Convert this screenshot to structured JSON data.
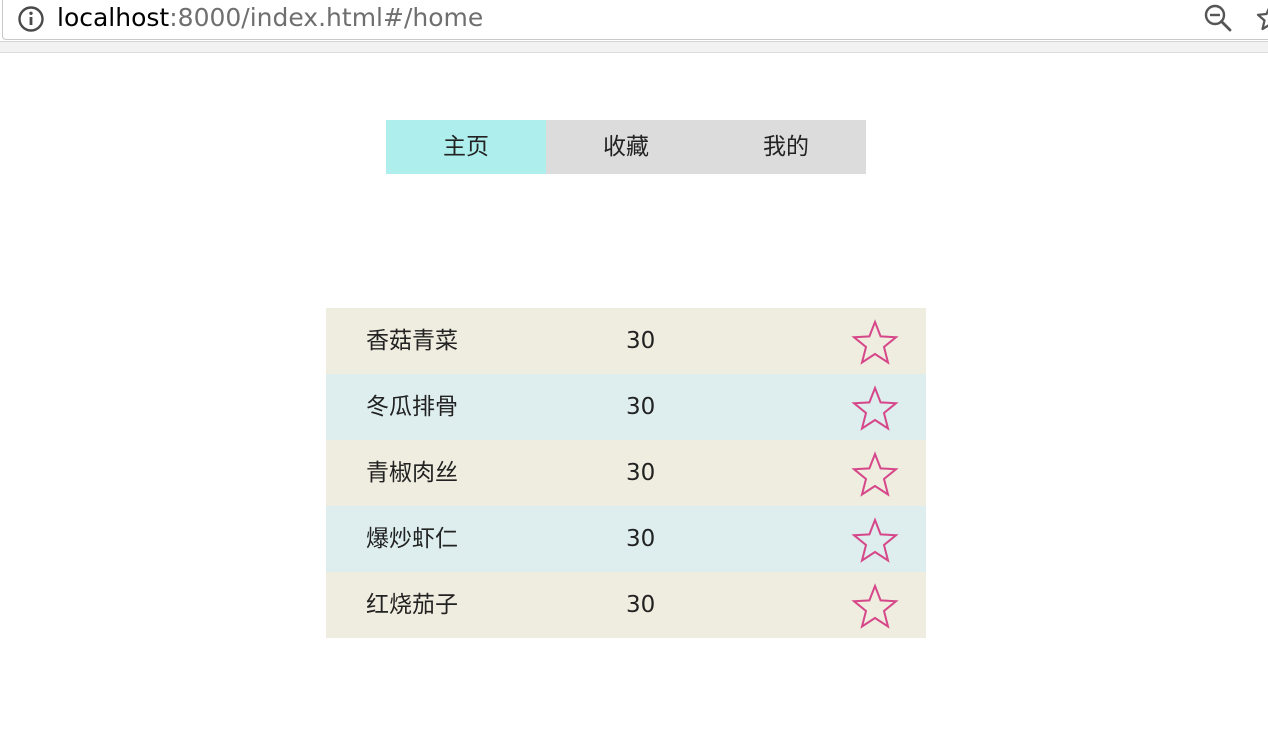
{
  "browser": {
    "url_host": "localhost",
    "url_rest": ":8000/index.html#/home"
  },
  "tabs": [
    {
      "label": "主页",
      "active": true
    },
    {
      "label": "收藏",
      "active": false
    },
    {
      "label": "我的",
      "active": false
    }
  ],
  "dishes": [
    {
      "name": "香菇青菜",
      "price": "30"
    },
    {
      "name": "冬瓜排骨",
      "price": "30"
    },
    {
      "name": "青椒肉丝",
      "price": "30"
    },
    {
      "name": "爆炒虾仁",
      "price": "30"
    },
    {
      "name": "红烧茄子",
      "price": "30"
    }
  ],
  "colors": {
    "tab_active": "#aeeeed",
    "tab_inactive": "#dcdcdc",
    "row_odd": "#eeeddf",
    "row_even": "#deeeee",
    "star": "#d6478a"
  },
  "icons": {
    "info": "info-icon",
    "zoom": "zoom-out-icon",
    "bookmark": "star-icon",
    "favorite": "star-outline-icon"
  }
}
